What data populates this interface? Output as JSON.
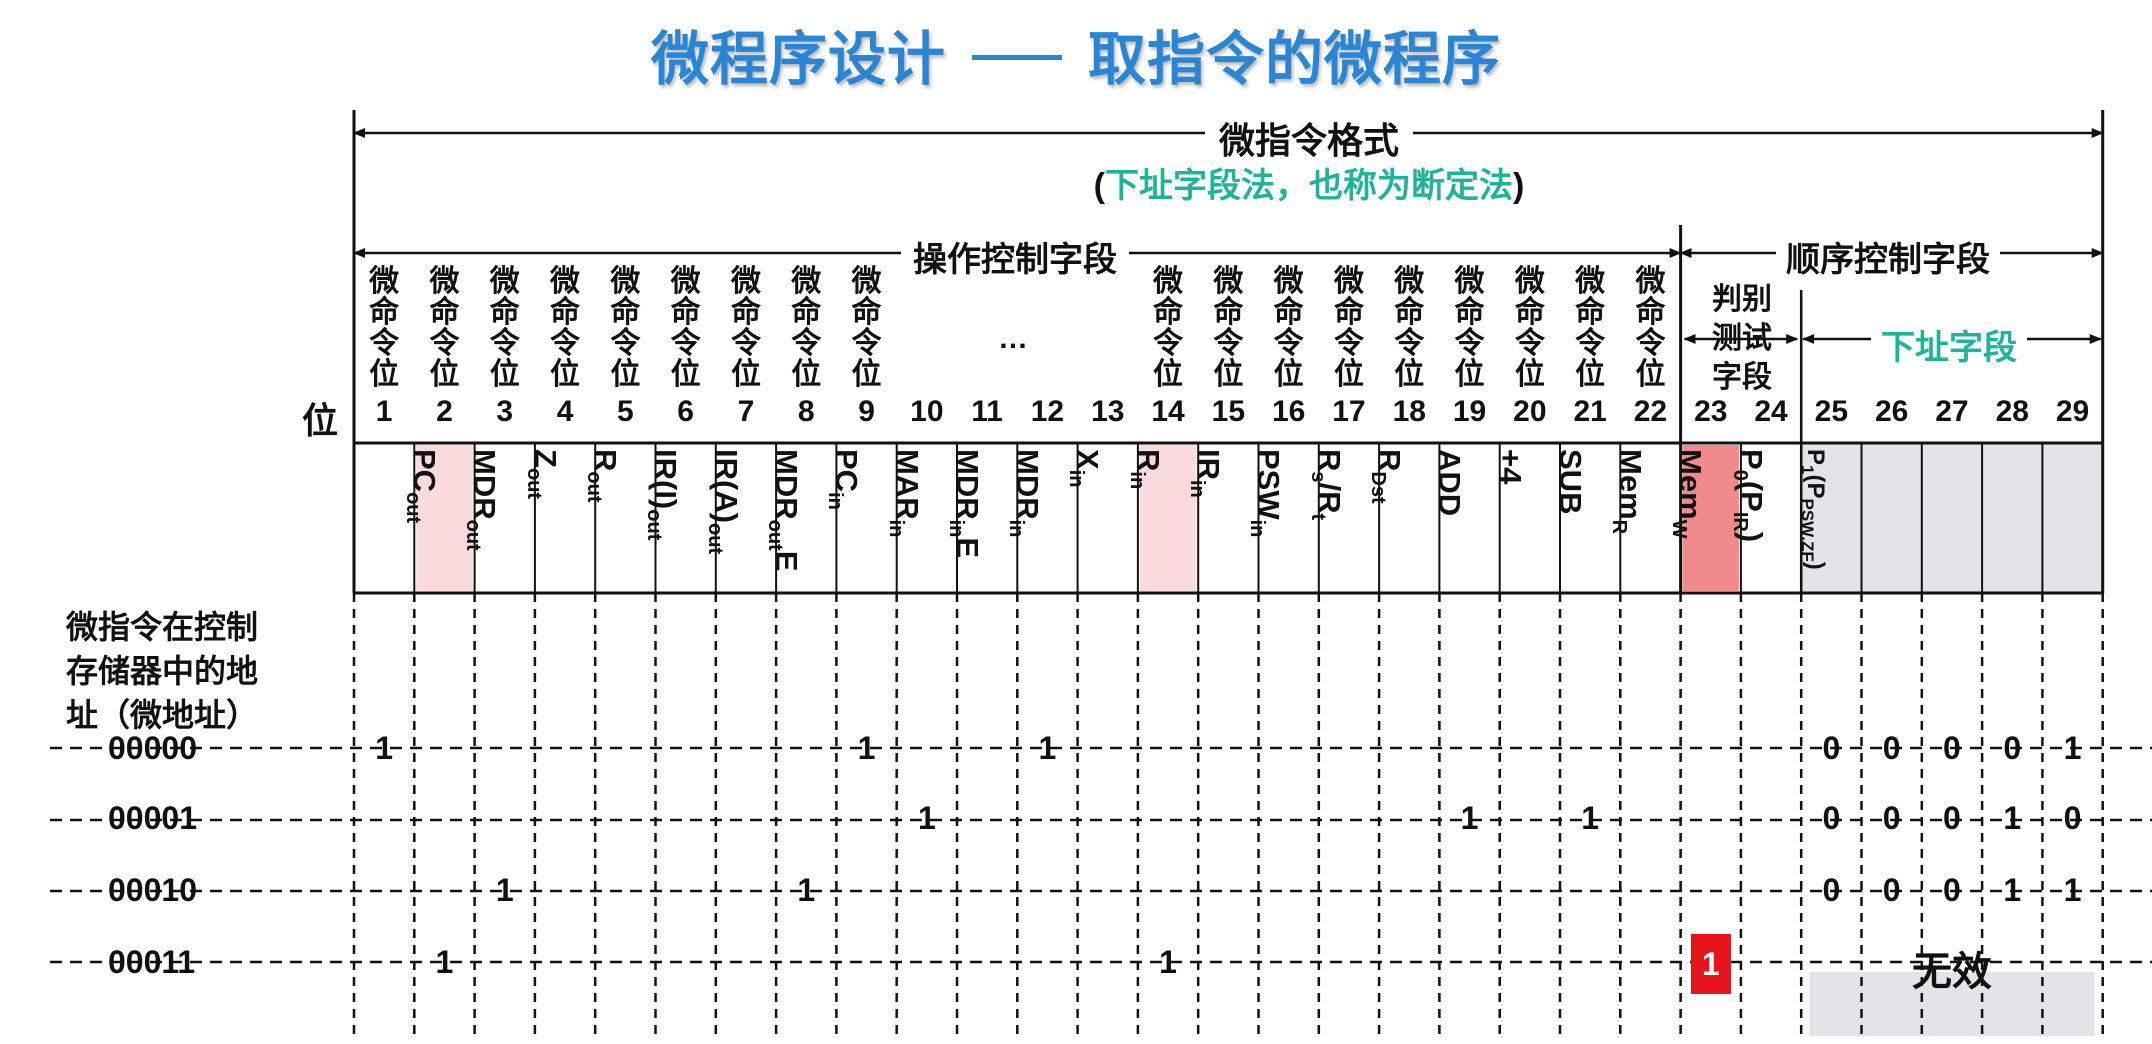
{
  "title": {
    "main": "微程序设计",
    "sub": "取指令的微程序"
  },
  "format": {
    "title": "微指令格式",
    "subtitle": "下址字段法，也称为断定法",
    "open": "(",
    "close": ")"
  },
  "fields": {
    "operation": "操作控制字段",
    "sequence": "顺序控制字段",
    "test": [
      "判别",
      "测试",
      "字段"
    ],
    "next": "下址字段",
    "ellipsis": "…"
  },
  "row_labels": {
    "bit": "位",
    "addr_header": [
      "微指令在控制",
      "存储器中的地",
      "址（微地址）"
    ]
  },
  "micro_label": [
    "微",
    "命",
    "令",
    "位"
  ],
  "bits": [
    "1",
    "2",
    "3",
    "4",
    "5",
    "6",
    "7",
    "8",
    "9",
    "10",
    "11",
    "12",
    "13",
    "14",
    "15",
    "16",
    "17",
    "18",
    "19",
    "20",
    "21",
    "22",
    "23",
    "24",
    "25",
    "26",
    "27",
    "28",
    "29"
  ],
  "signals": [
    {
      "main": "PC",
      "sub": "out"
    },
    {
      "main": "MDR",
      "sub": "out",
      "highlight": "#fadadd"
    },
    {
      "main": "Z",
      "sub": "out"
    },
    {
      "main": "R",
      "sub": "out"
    },
    {
      "main": "IR(I)",
      "sub": "out"
    },
    {
      "main": "IR(A)",
      "sub": "out"
    },
    {
      "main": "MDR",
      "sub": "out",
      "tail": "E"
    },
    {
      "main": "PC",
      "sub": "in"
    },
    {
      "main": "MAR",
      "sub": "in"
    },
    {
      "main": "MDR",
      "sub": "in",
      "tail": "E"
    },
    {
      "main": "MDR",
      "sub": "in"
    },
    {
      "main": "X",
      "sub": "in"
    },
    {
      "main": "R",
      "sub": "in"
    },
    {
      "main": "IR",
      "sub": "in",
      "highlight": "#fadadd"
    },
    {
      "main": "PSW",
      "sub": "in"
    },
    {
      "main": "R",
      "sub": "s",
      "tail": "/R",
      "sub2": "t"
    },
    {
      "main": "R",
      "sub": "Dst"
    },
    {
      "main": "ADD",
      "sub": ""
    },
    {
      "main": "+4",
      "sub": ""
    },
    {
      "main": "SUB",
      "sub": ""
    },
    {
      "main": "Mem",
      "sub": "R"
    },
    {
      "main": "Mem",
      "sub": "W"
    },
    {
      "main": "P",
      "sub": "0",
      "tail": "(P",
      "sub2": "IR",
      "tail2": ")",
      "highlight": "#f18b8b"
    },
    {
      "main": "P",
      "sub": "1",
      "tail": "(P",
      "sub2": "PSW.ZF",
      "tail2": ")",
      "small": true
    }
  ],
  "rows": [
    {
      "addr": "00000",
      "ones": [
        1,
        9,
        12
      ],
      "next": [
        "0",
        "0",
        "0",
        "0",
        "1"
      ]
    },
    {
      "addr": "00001",
      "ones": [
        10,
        19,
        21
      ],
      "next": [
        "0",
        "0",
        "0",
        "1",
        "0"
      ]
    },
    {
      "addr": "00010",
      "ones": [
        3,
        8
      ],
      "next": [
        "0",
        "0",
        "0",
        "1",
        "1"
      ]
    },
    {
      "addr": "00011",
      "ones": [
        2,
        14
      ],
      "p0": "1",
      "next_text": "无效"
    }
  ],
  "one_label": "1",
  "colors": {
    "title": "#2a86d4",
    "teal": "#1fb39b",
    "highlight_red": "#e8141c",
    "pink": "#fadadd",
    "gray": "#e3e4e9"
  }
}
